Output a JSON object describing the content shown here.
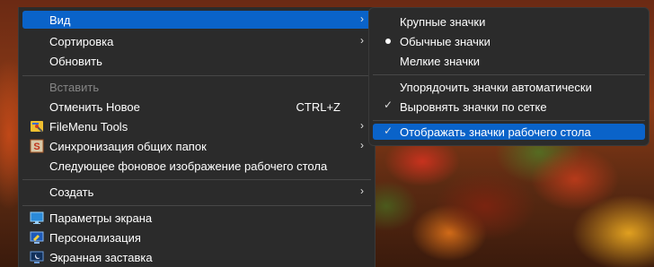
{
  "main_menu": {
    "items": [
      {
        "label": "Вид",
        "has_submenu": true,
        "highlighted": true
      },
      {
        "label": "Сортировка",
        "has_submenu": true
      },
      {
        "label": "Обновить"
      },
      {
        "label": "Вставить",
        "disabled": true
      },
      {
        "label": "Отменить Новое",
        "shortcut": "CTRL+Z"
      },
      {
        "label": "FileMenu Tools",
        "has_submenu": true,
        "icon": "filemenu-tools-icon"
      },
      {
        "label": "Синхронизация общих папок",
        "has_submenu": true,
        "icon": "sync-folders-icon"
      },
      {
        "label": "Следующее фоновое изображение рабочего стола"
      },
      {
        "label": "Создать",
        "has_submenu": true
      },
      {
        "label": "Параметры экрана",
        "icon": "display-settings-icon"
      },
      {
        "label": "Персонализация",
        "icon": "personalization-icon"
      },
      {
        "label": "Экранная заставка",
        "icon": "screensaver-icon"
      }
    ]
  },
  "view_submenu": {
    "items": [
      {
        "label": "Крупные значки"
      },
      {
        "label": "Обычные значки",
        "selected": true
      },
      {
        "label": "Мелкие значки"
      },
      {
        "label": "Упорядочить значки автоматически"
      },
      {
        "label": "Выровнять значки по сетке",
        "checked": true
      },
      {
        "label": "Отображать значки рабочего стола",
        "checked": true,
        "highlighted": true
      }
    ]
  },
  "glyphs": {
    "arrow": "›",
    "check": "✓"
  },
  "colors": {
    "menu_bg": "#2b2b2b",
    "highlight": "#0a63c9",
    "disabled_text": "#858585",
    "separator": "#474747"
  }
}
